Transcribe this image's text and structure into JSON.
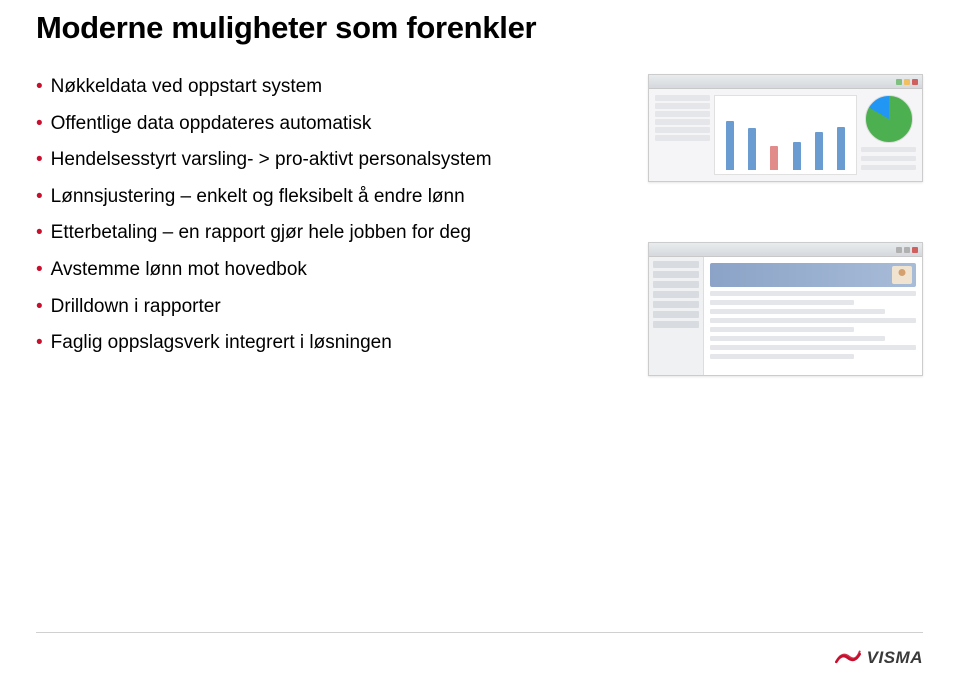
{
  "title": "Moderne muligheter som forenkler",
  "bullets": [
    "Nøkkeldata ved oppstart system",
    "Offentlige data oppdateres automatisk",
    "Hendelsesstyrt varsling- > pro-aktivt personalsystem",
    "Lønnsjustering – enkelt og fleksibelt å endre lønn",
    "Etterbetaling – en rapport gjør hele jobben for deg",
    "Avstemme lønn mot hovedbok",
    "Drilldown i rapporter",
    "Faglig oppslagsverk integrert i løsningen"
  ],
  "footer": {
    "brand_name": "VISMA"
  },
  "colors": {
    "accent": "#C8102E",
    "text": "#000000"
  }
}
